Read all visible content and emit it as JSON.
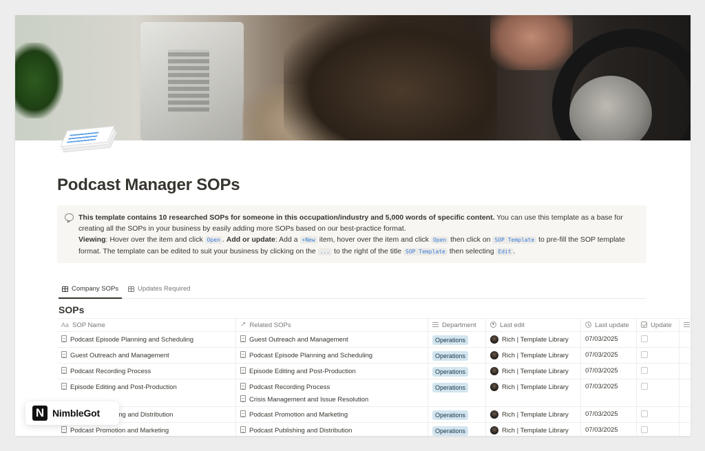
{
  "page": {
    "title": "Podcast Manager SOPs"
  },
  "callout": {
    "bold_intro": "This template contains 10 researched SOPs for someone in this occupation/industry and 5,000 words of specific content.",
    "intro_rest": " You can use this template as a base for creating all the SOPs in your business by easily adding more SOPs based on our best-practice format.",
    "viewing_label": "Viewing",
    "viewing_text_a": ": Hover over the item and click ",
    "open_code": "Open",
    "add_label": "Add or update",
    "add_text_a": ": Add a ",
    "new_code": "+New",
    "add_text_b": " item, hover over the item and click ",
    "add_text_c": " then click on ",
    "sop_template_code": "SOP Template",
    "add_text_d": " to pre-fill the SOP template format. The template can be edited to suit your business by clicking on the ",
    "dots_code": "...",
    "add_text_e": " to the right of the title ",
    "add_text_f": " then selecting ",
    "edit_code": "Edit",
    "add_text_g": "."
  },
  "tabs": [
    {
      "label": "Company SOPs",
      "active": true
    },
    {
      "label": "Updates Required",
      "active": false
    }
  ],
  "database": {
    "title": "SOPs",
    "columns": {
      "name": "SOP Name",
      "name_prefix": "Aa",
      "related": "Related SOPs",
      "department": "Department",
      "last_edit": "Last edit",
      "last_update": "Last update",
      "update": "Update"
    },
    "rows": [
      {
        "name": "Podcast Episode Planning and Scheduling",
        "related": [
          "Guest Outreach and Management"
        ],
        "department": "Operations",
        "editor": "Rich | Template Library",
        "date": "07/03/2025"
      },
      {
        "name": "Guest Outreach and Management",
        "related": [
          "Podcast Episode Planning and Scheduling"
        ],
        "department": "Operations",
        "editor": "Rich | Template Library",
        "date": "07/03/2025"
      },
      {
        "name": "Podcast Recording Process",
        "related": [
          "Episode Editing and Post-Production"
        ],
        "department": "Operations",
        "editor": "Rich | Template Library",
        "date": "07/03/2025"
      },
      {
        "name": "Episode Editing and Post-Production",
        "related": [
          "Podcast Recording Process",
          "Crisis Management and Issue Resolution"
        ],
        "department": "Operations",
        "editor": "Rich | Template Library",
        "date": "07/03/2025"
      },
      {
        "name": "Podcast Publishing and Distribution",
        "related": [
          "Podcast Promotion and Marketing"
        ],
        "department": "Operations",
        "editor": "Rich | Template Library",
        "date": "07/03/2025"
      },
      {
        "name": "Podcast Promotion and Marketing",
        "related": [
          "Podcast Publishing and Distribution"
        ],
        "department": "Operations",
        "editor": "Rich | Template Library",
        "date": "07/03/2025"
      }
    ]
  },
  "badge": {
    "logo_letter": "N",
    "brand": "NimbleGot"
  },
  "colors": {
    "tag_bg": "#d3e5ef",
    "code_text": "#3a7bd5",
    "callout_bg": "#f7f6f3"
  }
}
